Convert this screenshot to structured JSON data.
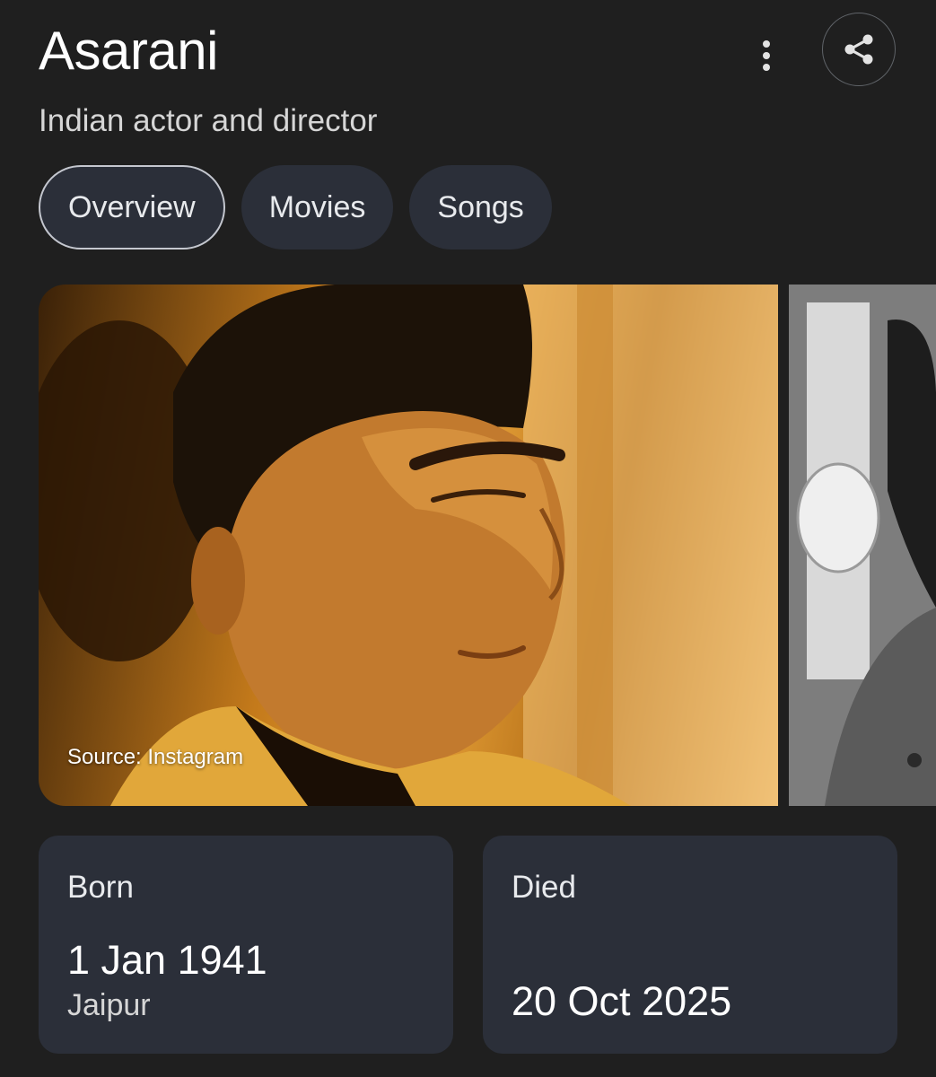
{
  "header": {
    "title": "Asarani",
    "subtitle": "Indian actor and director"
  },
  "actions": {
    "more_icon": "more-vert-icon",
    "share_icon": "share-icon"
  },
  "tabs": [
    {
      "label": "Overview",
      "active": true
    },
    {
      "label": "Movies",
      "active": false
    },
    {
      "label": "Songs",
      "active": false
    }
  ],
  "images": {
    "main_source": "Source: Instagram"
  },
  "facts": {
    "born": {
      "label": "Born",
      "date": "1 Jan 1941",
      "place": "Jaipur"
    },
    "died": {
      "label": "Died",
      "date": "20 Oct 2025"
    }
  },
  "colors": {
    "background": "#1f1f1f",
    "chip": "#2b2f39",
    "text": "#e3e3e3"
  }
}
